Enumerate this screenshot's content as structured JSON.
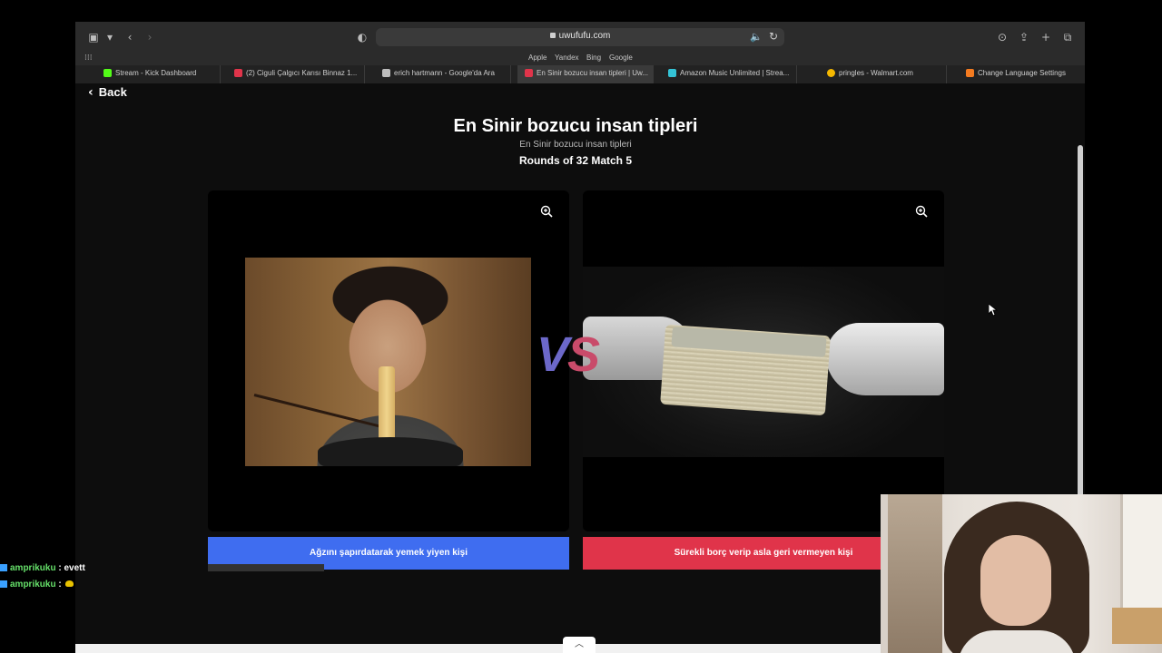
{
  "browser": {
    "url": "uwufufu.com",
    "favorites": [
      "Apple",
      "Yandex",
      "Bing",
      "Google"
    ],
    "tabs": [
      {
        "label": "Stream - Kick Dashboard",
        "color": "#53fc18",
        "active": false
      },
      {
        "label": "(2) Ciguli Çalgıcı Karısı Binnaz 1...",
        "color": "#e0344a",
        "active": false
      },
      {
        "label": "erich hartmann - Google'da Ara",
        "color": "#bdbdbd",
        "active": false
      },
      {
        "label": "En Sinir bozucu insan tipleri | Uw...",
        "color": "#e0344a",
        "active": true
      },
      {
        "label": "Amazon Music Unlimited | Strea...",
        "color": "#34c3d6",
        "active": false
      },
      {
        "label": "pringles - Walmart.com",
        "color": "#f5b800",
        "active": false
      },
      {
        "label": "Change Language Settings",
        "color": "#f47b20",
        "active": false
      }
    ]
  },
  "page": {
    "back_label": "Back",
    "title": "En Sinir bozucu insan tipleri",
    "subtitle": "En Sinir bozucu insan tipleri",
    "round": "Rounds of 32 Match 5",
    "vs_v": "V",
    "vs_s": "S",
    "left_choice": "Ağzını şapırdatarak yemek yiyen kişi",
    "right_choice": "Sürekli borç verip asla geri vermeyen kişi"
  },
  "chat": [
    {
      "user": "amprikuku",
      "message": ": evett"
    },
    {
      "user": "amprikuku",
      "message": ":"
    }
  ],
  "colors": {
    "left_button": "#3f6df0",
    "right_button": "#e0344a",
    "vs_v": "#6c68c9",
    "vs_s": "#c94b6a"
  }
}
